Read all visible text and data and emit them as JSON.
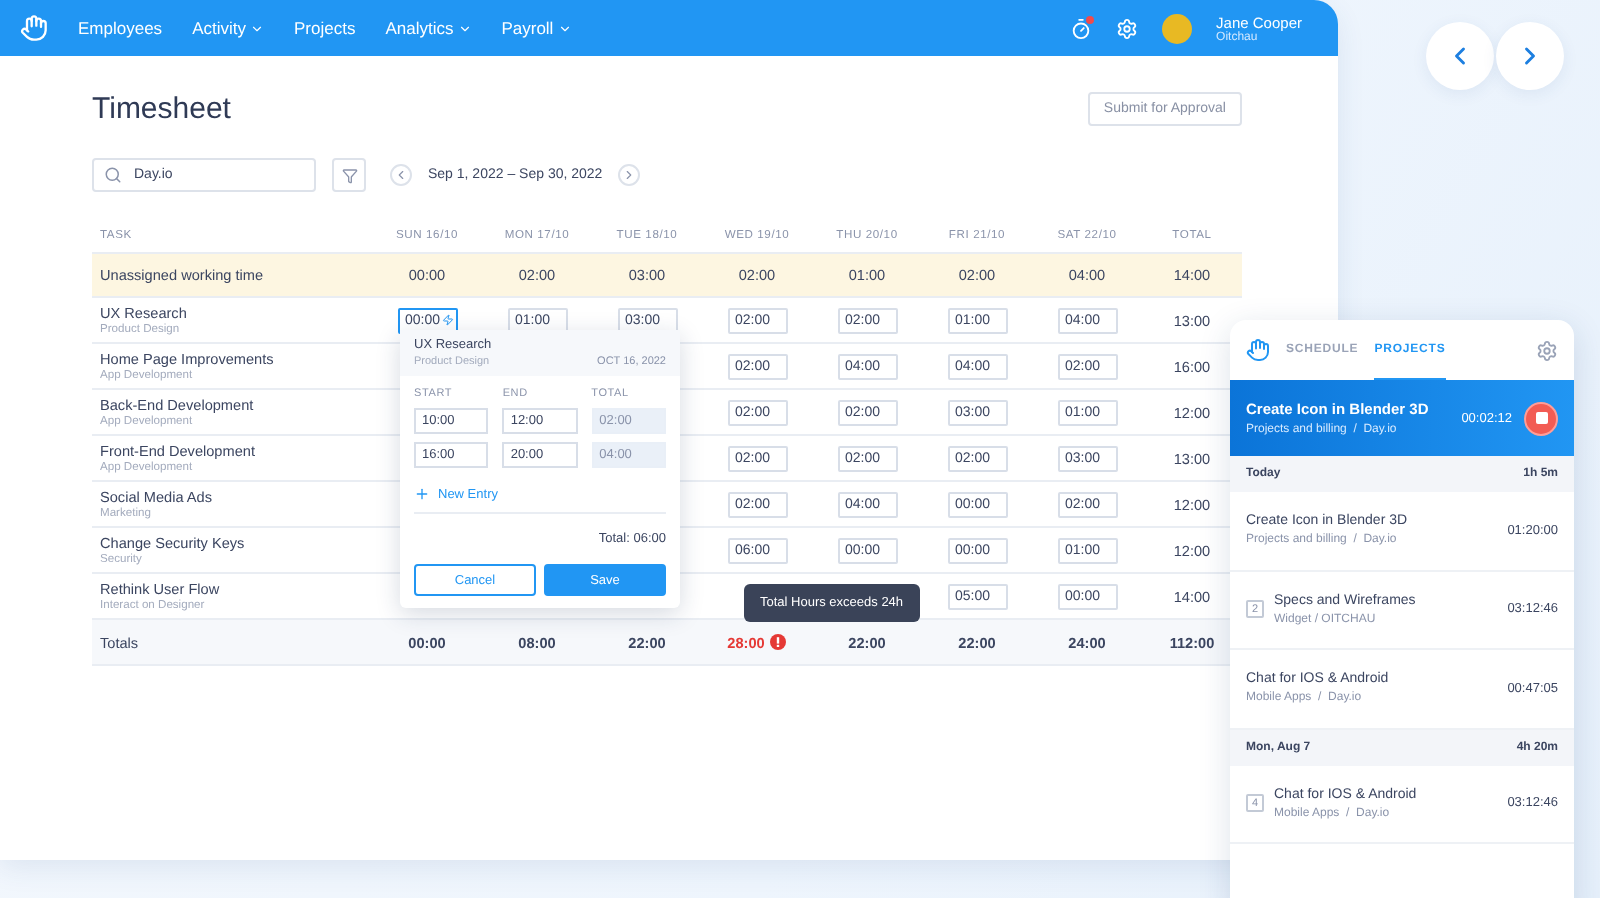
{
  "nav": {
    "items": [
      {
        "label": "Employees",
        "has_menu": false
      },
      {
        "label": "Activity",
        "has_menu": true
      },
      {
        "label": "Projects",
        "has_menu": false
      },
      {
        "label": "Analytics",
        "has_menu": true
      },
      {
        "label": "Payroll",
        "has_menu": true
      }
    ],
    "notification": true,
    "user": {
      "name": "Jane Cooper",
      "company": "Oitchau"
    }
  },
  "page": {
    "title": "Timesheet",
    "submit": "Submit for Approval",
    "search": {
      "value": "Day.io"
    },
    "date_range": "Sep 1, 2022 – Sep 30, 2022"
  },
  "table": {
    "task_column": "TASK",
    "day_columns": [
      "SUN 16/10",
      "MON 17/10",
      "TUE 18/10",
      "WED 19/10",
      "THU 20/10",
      "FRI 21/10",
      "SAT 22/10"
    ],
    "total_column": "TOTAL",
    "rows": [
      {
        "kind": "unassigned",
        "task": "Unassigned working time",
        "cells": [
          {
            "v": "00:00"
          },
          {
            "v": "02:00"
          },
          {
            "v": "03:00"
          },
          {
            "v": "02:00"
          },
          {
            "v": "01:00"
          },
          {
            "v": "02:00"
          },
          {
            "v": "04:00"
          }
        ],
        "total": "14:00"
      },
      {
        "kind": "task",
        "task": "UX Research",
        "category": "Product Design",
        "cells": [
          {
            "v": "00:00",
            "focused": true
          },
          {
            "v": "01:00",
            "focused": false
          },
          {
            "v": "03:00",
            "focused": false
          },
          {
            "v": "02:00",
            "focused": false
          },
          {
            "v": "02:00",
            "focused": false
          },
          {
            "v": "01:00",
            "focused": false
          },
          {
            "v": "04:00",
            "focused": false
          }
        ],
        "total": "13:00"
      },
      {
        "kind": "task",
        "task": "Home Page Improvements",
        "category": "App Development",
        "cells": [
          null,
          null,
          null,
          {
            "v": "02:00",
            "focused": false
          },
          {
            "v": "04:00",
            "focused": false
          },
          {
            "v": "04:00",
            "focused": false
          },
          {
            "v": "02:00",
            "focused": false
          }
        ],
        "total": "16:00"
      },
      {
        "kind": "task",
        "task": "Back-End Development",
        "category": "App Development",
        "cells": [
          null,
          null,
          null,
          {
            "v": "02:00",
            "focused": false
          },
          {
            "v": "02:00",
            "focused": false
          },
          {
            "v": "03:00",
            "focused": false
          },
          {
            "v": "01:00",
            "focused": false
          }
        ],
        "total": "12:00"
      },
      {
        "kind": "task",
        "task": "Front-End Development",
        "category": "App Development",
        "cells": [
          null,
          null,
          null,
          {
            "v": "02:00",
            "focused": false
          },
          {
            "v": "02:00",
            "focused": false
          },
          {
            "v": "02:00",
            "focused": false
          },
          {
            "v": "03:00",
            "focused": false
          }
        ],
        "total": "13:00"
      },
      {
        "kind": "task",
        "task": "Social Media Ads",
        "category": "Marketing",
        "cells": [
          null,
          null,
          null,
          {
            "v": "02:00",
            "focused": false
          },
          {
            "v": "04:00",
            "focused": false
          },
          {
            "v": "00:00",
            "focused": false
          },
          {
            "v": "02:00",
            "focused": false
          }
        ],
        "total": "12:00"
      },
      {
        "kind": "task",
        "task": "Change Security Keys",
        "category": "Security",
        "cells": [
          null,
          null,
          null,
          {
            "v": "06:00",
            "focused": false
          },
          {
            "v": "00:00",
            "focused": false
          },
          {
            "v": "00:00",
            "focused": false
          },
          {
            "v": "01:00",
            "focused": false
          }
        ],
        "total": "12:00"
      },
      {
        "kind": "task",
        "task": "Rethink User Flow",
        "category": "Interact on Designer",
        "cells": [
          null,
          null,
          null,
          null,
          null,
          {
            "v": "05:00",
            "focused": false
          },
          {
            "v": "00:00",
            "focused": false
          }
        ],
        "total": "14:00"
      },
      {
        "kind": "totals",
        "task": "Totals",
        "cells": [
          {
            "v": "00:00",
            "over": false
          },
          {
            "v": "08:00",
            "over": false
          },
          {
            "v": "22:00",
            "over": false
          },
          {
            "v": "28:00",
            "over": true
          },
          {
            "v": "22:00",
            "over": false
          },
          {
            "v": "22:00",
            "over": false
          },
          {
            "v": "24:00",
            "over": false
          }
        ],
        "total": "112:00"
      }
    ]
  },
  "popup": {
    "task": "UX Research",
    "category": "Product Design",
    "date": "OCT 16, 2022",
    "headers": [
      "START",
      "END",
      "TOTAL"
    ],
    "entries": [
      {
        "start": "10:00",
        "end": "12:00",
        "total": "02:00"
      },
      {
        "start": "16:00",
        "end": "20:00",
        "total": "04:00"
      }
    ],
    "new_entry": "New Entry",
    "total": "Total: 06:00",
    "cancel": "Cancel",
    "save": "Save"
  },
  "tooltip": "Total Hours exceeds 24h",
  "tracker": {
    "tabs": [
      {
        "label": "SCHEDULE",
        "selected": false
      },
      {
        "label": "PROJECTS",
        "selected": true
      }
    ],
    "running": {
      "title": "Create Icon in Blender 3D",
      "project": "Projects and billing  /  Day.io",
      "time": "00:02:12"
    },
    "groups": [
      {
        "label": "Today",
        "total": "1h 5m",
        "entries": [
          {
            "title": "Create Icon in Blender 3D",
            "project": "Projects and billing  /  Day.io",
            "time": "01:20:00"
          },
          {
            "title": "Specs and Wireframes",
            "project": "Widget / OITCHAU",
            "time": "03:12:46",
            "count": "2"
          },
          {
            "title": "Chat for IOS & Android",
            "project": "Mobile Apps  /  Day.io",
            "time": "00:47:05"
          }
        ]
      },
      {
        "label": "Mon, Aug 7",
        "total": "4h 20m",
        "entries": [
          {
            "title": "Chat for IOS & Android",
            "project": "Mobile Apps  /  Day.io",
            "time": "03:12:46",
            "count": "4"
          }
        ]
      }
    ]
  }
}
